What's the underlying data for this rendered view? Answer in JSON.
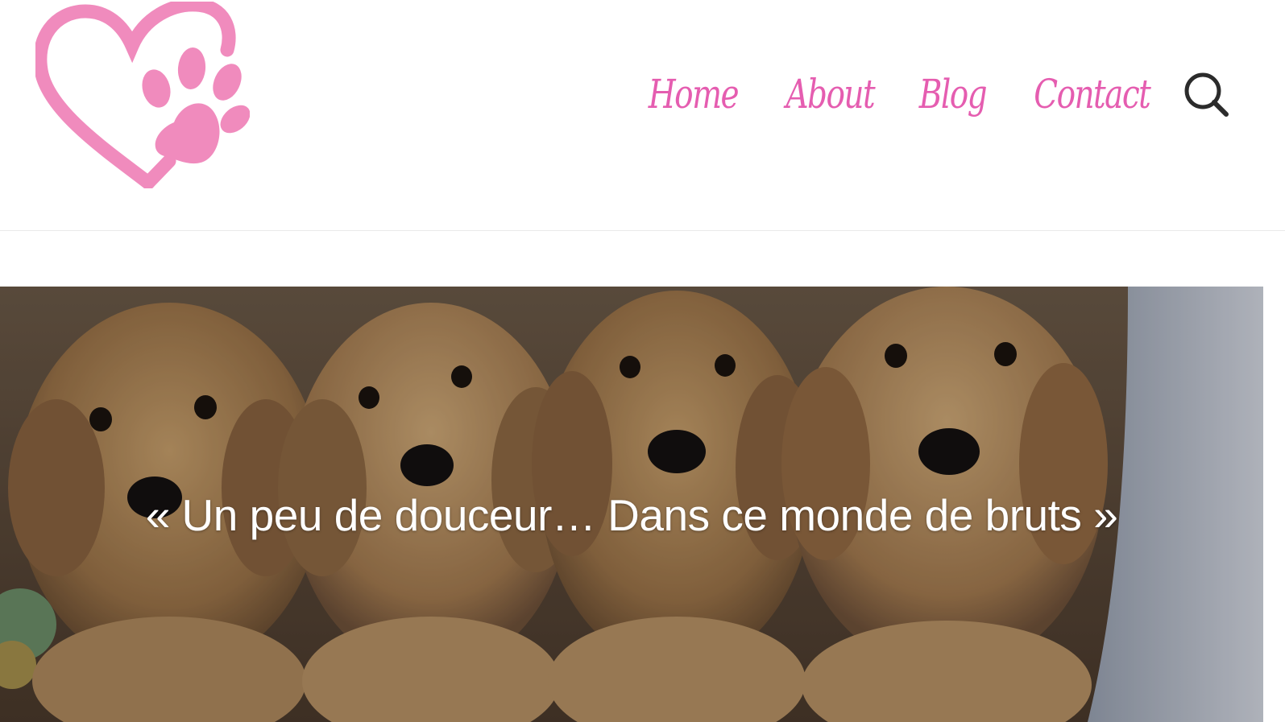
{
  "header": {
    "logo_icon": "heart-paw-logo",
    "nav": [
      {
        "label": "Home"
      },
      {
        "label": "About"
      },
      {
        "label": "Blog"
      },
      {
        "label": "Contact"
      }
    ],
    "search_icon": "search-icon"
  },
  "hero": {
    "quote": "« Un peu de douceur… Dans ce monde de bruts »",
    "image_subject": "four golden retriever puppies"
  },
  "colors": {
    "brand_pink": "#f08bbd",
    "nav_pink": "#e55db0",
    "icon_dark": "#2b2b2b"
  }
}
